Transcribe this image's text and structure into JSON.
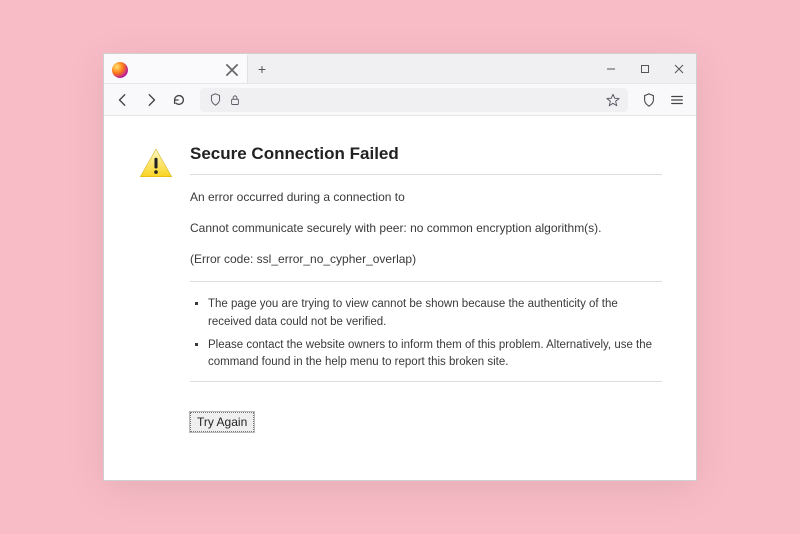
{
  "window": {
    "tab_title": "",
    "new_tab_label": "+"
  },
  "toolbar": {
    "url_value": "",
    "url_placeholder": ""
  },
  "error": {
    "title": "Secure Connection Failed",
    "line1": "An error occurred during a connection to",
    "line2": "Cannot communicate securely with peer: no common encryption algorithm(s).",
    "code_line": "(Error code: ssl_error_no_cypher_overlap)",
    "bullets": [
      "The page you are trying to view cannot be shown because the authenticity of the received data could not be verified.",
      "Please contact the website owners to inform them of this problem. Alternatively, use the command found in the help menu to report this broken site."
    ],
    "try_again_label": "Try Again"
  },
  "colors": {
    "page_bg": "#f8bcc6",
    "window_bg": "#ffffff",
    "chrome_bg": "#f9f9fb"
  }
}
